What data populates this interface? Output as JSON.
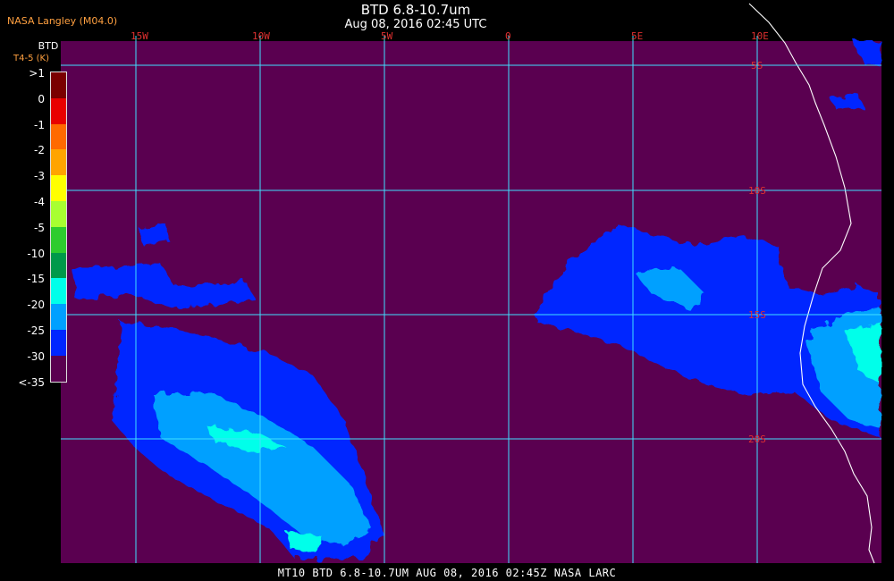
{
  "header": {
    "agency": "NASA Langley (M04.0)",
    "title": "BTD 6.8-10.7um",
    "subtitle": "Aug 08, 2016 02:45 UTC"
  },
  "legend": {
    "title": "BTD",
    "units": "T4-5 (K)",
    "labels": [
      ">1",
      "0",
      "-1",
      "-2",
      "-3",
      "-4",
      "-5",
      "-10",
      "-15",
      "-20",
      "-25",
      "-30",
      "<-35"
    ],
    "colors": [
      "#7a0000",
      "#e80000",
      "#ff6a00",
      "#ffa400",
      "#ffff00",
      "#a8ff30",
      "#2ecc2e",
      "#00994a",
      "#00ffea",
      "#00a0ff",
      "#0026ff",
      "#5a0050"
    ]
  },
  "map": {
    "background_color": "#5a0050",
    "grid_color": "#40e0ff",
    "coast_color": "#ffffff",
    "lon_labels": [
      "15W",
      "10W",
      "5W",
      "0",
      "5E",
      "10E"
    ],
    "lat_labels": [
      "5S",
      "10S",
      "15S",
      "20S"
    ],
    "label_color": "#e03030",
    "layers": [
      "BTD cloud field (blue shades)",
      "coastline",
      "lat/lon grid"
    ]
  },
  "footer": {
    "text": "MT10  BTD 6.8-10.7UM   AUG 08, 2016 02:45Z   NASA LARC"
  }
}
